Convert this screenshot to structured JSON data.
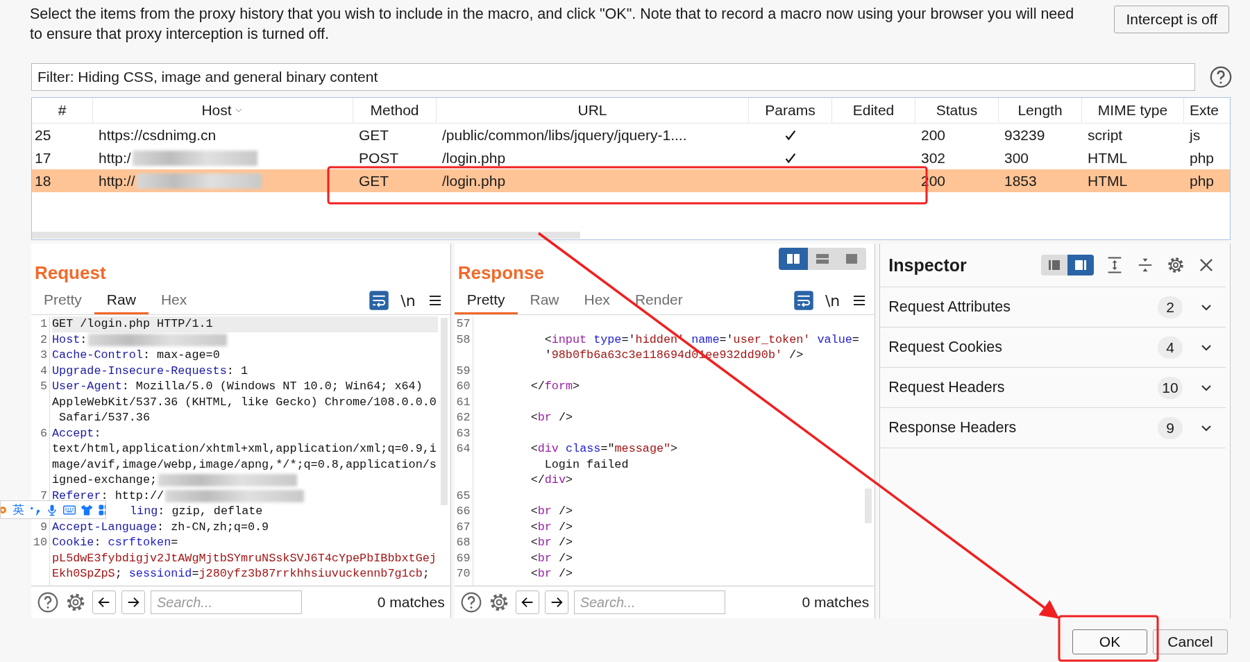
{
  "intro": "Select the items from the proxy history that you wish to include in the macro, and click \"OK\". Note that to record a macro now using your browser you will need to ensure that proxy interception is turned off.",
  "intercept_button": "Intercept is off",
  "filter": "Filter: Hiding CSS, image and general binary content",
  "table": {
    "columns": [
      {
        "label": "#",
        "sorted": false
      },
      {
        "label": "Host",
        "sorted": true
      },
      {
        "label": "Method",
        "sorted": false
      },
      {
        "label": "URL",
        "sorted": false
      },
      {
        "label": "Params",
        "sorted": false
      },
      {
        "label": "Edited",
        "sorted": false
      },
      {
        "label": "Status",
        "sorted": false
      },
      {
        "label": "Length",
        "sorted": false
      },
      {
        "label": "MIME type",
        "sorted": false
      },
      {
        "label": "Exte",
        "sorted": false
      }
    ],
    "rows": [
      {
        "num": "25",
        "host": "https://csdnimg.cn",
        "host_redacted": false,
        "method": "GET",
        "url": "/public/common/libs/jquery/jquery-1....",
        "params": true,
        "status": "200",
        "length": "93239",
        "mime": "script",
        "ext": "js",
        "selected": false
      },
      {
        "num": "17",
        "host": "http:/",
        "host_redacted": true,
        "method": "POST",
        "url": "/login.php",
        "params": true,
        "status": "302",
        "length": "300",
        "mime": "HTML",
        "ext": "php",
        "selected": false
      },
      {
        "num": "18",
        "host": "http://",
        "host_redacted": true,
        "method": "GET",
        "url": "/login.php",
        "params": false,
        "status": "200",
        "length": "1853",
        "mime": "HTML",
        "ext": "php",
        "selected": true
      }
    ]
  },
  "request": {
    "title": "Request",
    "tabs": [
      {
        "label": "Pretty",
        "selected": false
      },
      {
        "label": "Raw",
        "selected": true
      },
      {
        "label": "Hex",
        "selected": false
      }
    ],
    "wrap_on": true,
    "newline_label": "\\n",
    "lines": [
      {
        "num": "1",
        "selected": true,
        "rows": [
          {
            "tokens": [
              {
                "t": "GET /login.php HTTP/1.1",
                "kind": "plain"
              }
            ]
          }
        ]
      },
      {
        "num": "2",
        "selected": false,
        "redacted": true,
        "rows": [
          {
            "tokens": [
              {
                "t": "Host",
                "kind": "key"
              },
              {
                "t": ":",
                "kind": "plain"
              }
            ]
          }
        ]
      },
      {
        "num": "3",
        "selected": false,
        "rows": [
          {
            "tokens": [
              {
                "t": "Cache-Control",
                "kind": "key"
              },
              {
                "t": ": max-age=0",
                "kind": "plain"
              }
            ]
          }
        ]
      },
      {
        "num": "4",
        "selected": false,
        "rows": [
          {
            "tokens": [
              {
                "t": "Upgrade-Insecure-Requests",
                "kind": "key"
              },
              {
                "t": ": 1",
                "kind": "plain"
              }
            ]
          }
        ]
      },
      {
        "num": "5",
        "selected": false,
        "rows": [
          {
            "tokens": [
              {
                "t": "User-Agent",
                "kind": "key"
              },
              {
                "t": ": Mozilla/5.0 (Windows NT 10.0; Win64; x64)",
                "kind": "plain"
              }
            ]
          },
          {
            "tokens": [
              {
                "t": "AppleWebKit/537.36 (KHTML, like Gecko) Chrome/108.0.0.0",
                "kind": "plain"
              }
            ]
          },
          {
            "tokens": [
              {
                "t": " Safari/537.36",
                "kind": "plain"
              }
            ]
          }
        ]
      },
      {
        "num": "6",
        "selected": false,
        "redacted": true,
        "rows": [
          {
            "tokens": [
              {
                "t": "Accept",
                "kind": "key"
              },
              {
                "t": ":",
                "kind": "plain"
              }
            ]
          },
          {
            "tokens": [
              {
                "t": "text/html,application/xhtml+xml,application/xml;q=0.9,i",
                "kind": "plain"
              }
            ]
          },
          {
            "tokens": [
              {
                "t": "mage/avif,image/webp,image/apng,*/*;q=0.8,application/s",
                "kind": "plain"
              }
            ]
          },
          {
            "tokens": [
              {
                "t": "igned-exchange;",
                "kind": "plain"
              }
            ]
          }
        ]
      },
      {
        "num": "7",
        "selected": false,
        "redacted": true,
        "rows": [
          {
            "tokens": [
              {
                "t": "Referer",
                "kind": "key"
              },
              {
                "t": ": http://",
                "kind": "plain"
              }
            ]
          }
        ]
      },
      {
        "selected": false,
        "covered": true,
        "rows": [
          {
            "tokens": [
              {
                "t": "ling",
                "kind": "key"
              },
              {
                "t": ": gzip, deflate",
                "kind": "plain"
              }
            ]
          }
        ]
      },
      {
        "num": "9",
        "selected": false,
        "rows": [
          {
            "tokens": [
              {
                "t": "Accept-Language",
                "kind": "key"
              },
              {
                "t": ": zh-CN,zh;q=0.9",
                "kind": "plain"
              }
            ]
          }
        ]
      },
      {
        "num": "10",
        "selected": false,
        "rows": [
          {
            "tokens": [
              {
                "t": "Cookie",
                "kind": "key"
              },
              {
                "t": ": ",
                "kind": "plain"
              },
              {
                "t": "csrftoken",
                "kind": "attr"
              },
              {
                "t": "=",
                "kind": "plain"
              }
            ]
          },
          {
            "tokens": [
              {
                "t": "pL5dwE3fybdigjv2JtAWgMjtbSYmruNSskSVJ6T4cYpePbIBbbxtGej",
                "kind": "val"
              }
            ]
          },
          {
            "tokens": [
              {
                "t": "Ekh0SpZpS",
                "kind": "val"
              },
              {
                "t": "; ",
                "kind": "plain"
              },
              {
                "t": "sessionid",
                "kind": "attr"
              },
              {
                "t": "=",
                "kind": "plain"
              },
              {
                "t": "j280yfz3b87rrkhhsiuvuckennb7g1cb",
                "kind": "val"
              },
              {
                "t": ";",
                "kind": "plain"
              }
            ]
          }
        ]
      }
    ],
    "search": {
      "placeholder": "Search...",
      "matches": "0 matches"
    }
  },
  "response": {
    "title": "Response",
    "view_modes": [
      {
        "kind": "columns",
        "selected": true
      },
      {
        "kind": "rows",
        "selected": false
      },
      {
        "kind": "single",
        "selected": false
      }
    ],
    "tabs": [
      {
        "label": "Pretty",
        "selected": true
      },
      {
        "label": "Raw",
        "selected": false
      },
      {
        "label": "Hex",
        "selected": false
      },
      {
        "label": "Render",
        "selected": false
      }
    ],
    "wrap_on": true,
    "newline_label": "\\n",
    "lines": [
      {
        "num": "57"
      },
      {
        "num": "58",
        "rows": [
          {
            "kind": "inner",
            "tokens": [
              {
                "t": "<",
                "kind": "plain"
              },
              {
                "t": "input",
                "kind": "tag"
              },
              {
                "t": " type",
                "kind": "attr"
              },
              {
                "t": "='",
                "kind": "plain"
              },
              {
                "t": "hidden'",
                "kind": "val"
              },
              {
                "t": " name",
                "kind": "attr"
              },
              {
                "t": "='",
                "kind": "plain"
              },
              {
                "t": "user_token'",
                "kind": "val"
              },
              {
                "t": " value",
                "kind": "attr"
              },
              {
                "t": "=",
                "kind": "plain"
              }
            ]
          },
          {
            "kind": "inner",
            "tokens": [
              {
                "t": "'",
                "kind": "plain"
              },
              {
                "t": "98b0fb6a63c3e118694d01ee932dd90b'",
                "kind": "val"
              },
              {
                "t": " />",
                "kind": "plain"
              }
            ]
          }
        ]
      },
      {
        "num": "59"
      },
      {
        "num": "60",
        "rows": [
          {
            "kind": "outer",
            "tokens": [
              {
                "t": "</",
                "kind": "plain"
              },
              {
                "t": "form",
                "kind": "tag"
              },
              {
                "t": ">",
                "kind": "plain"
              }
            ]
          }
        ]
      },
      {
        "num": "61"
      },
      {
        "num": "62",
        "rows": [
          {
            "kind": "outer",
            "tokens": [
              {
                "t": "<",
                "kind": "plain"
              },
              {
                "t": "br",
                "kind": "tag"
              },
              {
                "t": " />",
                "kind": "plain"
              }
            ]
          }
        ]
      },
      {
        "num": "63"
      },
      {
        "num": "64",
        "rows": [
          {
            "kind": "outer",
            "tokens": [
              {
                "t": "<",
                "kind": "plain"
              },
              {
                "t": "div",
                "kind": "tag"
              },
              {
                "t": " class",
                "kind": "attr"
              },
              {
                "t": "=\"",
                "kind": "plain"
              },
              {
                "t": "message\"",
                "kind": "val"
              },
              {
                "t": ">",
                "kind": "plain"
              }
            ]
          },
          {
            "kind": "content",
            "tokens": [
              {
                "t": "Login failed",
                "kind": "plain"
              }
            ]
          },
          {
            "kind": "outer",
            "tokens": [
              {
                "t": "</",
                "kind": "plain"
              },
              {
                "t": "div",
                "kind": "tag"
              },
              {
                "t": ">",
                "kind": "plain"
              }
            ]
          }
        ]
      },
      {
        "num": "65"
      },
      {
        "num": "66",
        "rows": [
          {
            "kind": "outer",
            "tokens": [
              {
                "t": "<",
                "kind": "plain"
              },
              {
                "t": "br",
                "kind": "tag"
              },
              {
                "t": " />",
                "kind": "plain"
              }
            ]
          }
        ]
      },
      {
        "num": "67",
        "rows": [
          {
            "kind": "outer",
            "tokens": [
              {
                "t": "<",
                "kind": "plain"
              },
              {
                "t": "br",
                "kind": "tag"
              },
              {
                "t": " />",
                "kind": "plain"
              }
            ]
          }
        ]
      },
      {
        "num": "68",
        "rows": [
          {
            "kind": "outer",
            "tokens": [
              {
                "t": "<",
                "kind": "plain"
              },
              {
                "t": "br",
                "kind": "tag"
              },
              {
                "t": " />",
                "kind": "plain"
              }
            ]
          }
        ]
      },
      {
        "num": "69",
        "rows": [
          {
            "kind": "outer",
            "tokens": [
              {
                "t": "<",
                "kind": "plain"
              },
              {
                "t": "br",
                "kind": "tag"
              },
              {
                "t": " />",
                "kind": "plain"
              }
            ]
          }
        ]
      },
      {
        "num": "70",
        "rows": [
          {
            "kind": "outer",
            "tokens": [
              {
                "t": "<",
                "kind": "plain"
              },
              {
                "t": "br",
                "kind": "tag"
              },
              {
                "t": " />",
                "kind": "plain"
              }
            ]
          }
        ]
      }
    ],
    "search": {
      "placeholder": "Search...",
      "matches": "0 matches"
    }
  },
  "inspector": {
    "title": "Inspector",
    "panel_modes": [
      {
        "kind": "left",
        "selected": false
      },
      {
        "kind": "right",
        "selected": true
      }
    ],
    "sections": [
      {
        "label": "Request Attributes",
        "count": "2"
      },
      {
        "label": "Request Cookies",
        "count": "4"
      },
      {
        "label": "Request Headers",
        "count": "10"
      },
      {
        "label": "Response Headers",
        "count": "9"
      }
    ]
  },
  "buttons": [
    {
      "label": "OK",
      "kind": "primary"
    },
    {
      "label": "Cancel",
      "kind": "plain"
    }
  ],
  "ime_toolbar": {
    "label": "英"
  },
  "annotations": [
    {
      "kind": "box"
    },
    {
      "kind": "arrow"
    },
    {
      "kind": "box"
    }
  ]
}
